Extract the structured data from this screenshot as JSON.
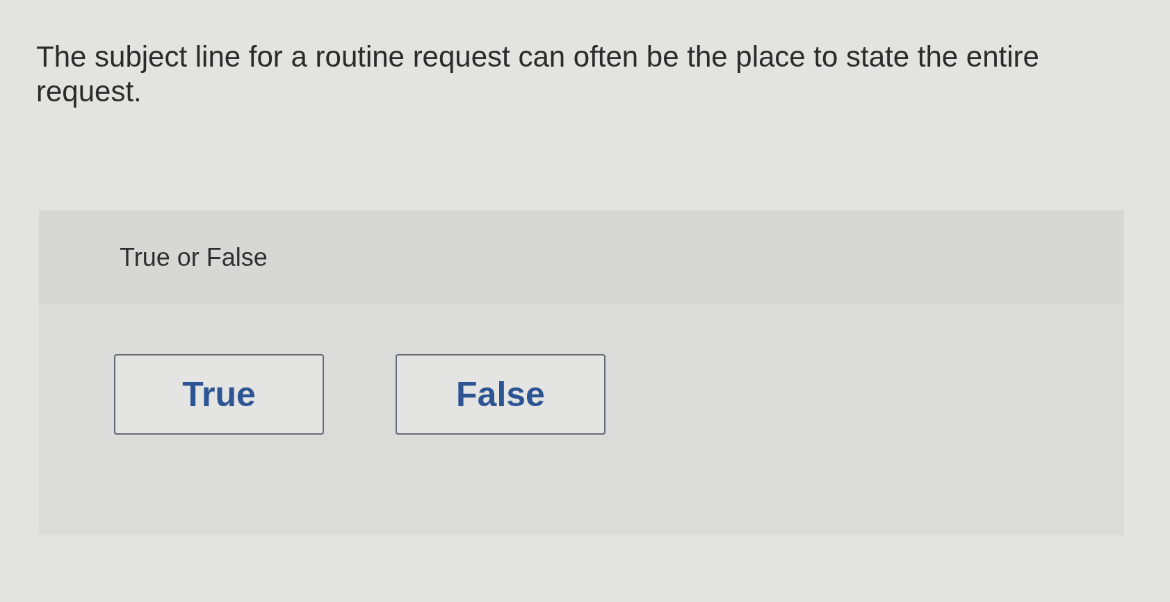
{
  "question": "The subject line for a routine request can often be the place to state the entire request.",
  "answer_panel": {
    "prompt": "True or False",
    "options": [
      {
        "label": "True",
        "selected": false
      },
      {
        "label": "False",
        "selected": false
      }
    ]
  }
}
